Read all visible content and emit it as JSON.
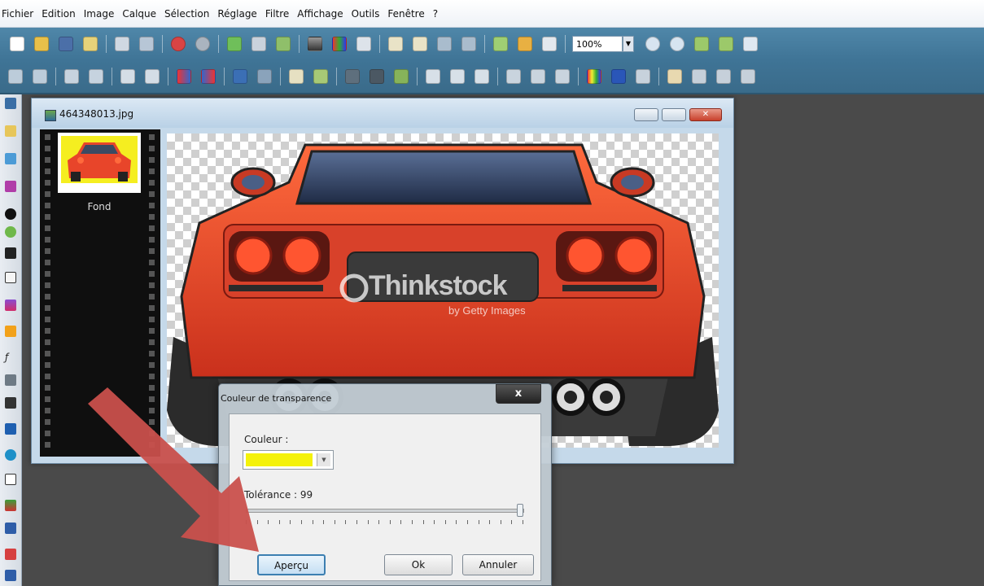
{
  "menu": [
    "Fichier",
    "Edition",
    "Image",
    "Calque",
    "Sélection",
    "Réglage",
    "Filtre",
    "Affichage",
    "Outils",
    "Fenêtre",
    "?"
  ],
  "toolbar": {
    "zoom_value": "100%"
  },
  "image_window": {
    "title": "464348013.jpg",
    "layer_name": "Fond",
    "watermark_brand": "Thinkstock",
    "watermark_sub": "by Getty Images"
  },
  "dialog": {
    "title": "Couleur de transparence",
    "close_label": "x",
    "color_label": "Couleur :",
    "color_value": "#f4f20a",
    "tolerance_label": "Tolérance : 99",
    "tolerance_value": 99,
    "buttons": {
      "preview": "Aperçu",
      "ok": "Ok",
      "cancel": "Annuler"
    }
  },
  "colors": {
    "toolbar": "#4a80a3",
    "workspace": "#4a4a4a",
    "car": "#e8452a",
    "arrow": "#c9504c"
  }
}
